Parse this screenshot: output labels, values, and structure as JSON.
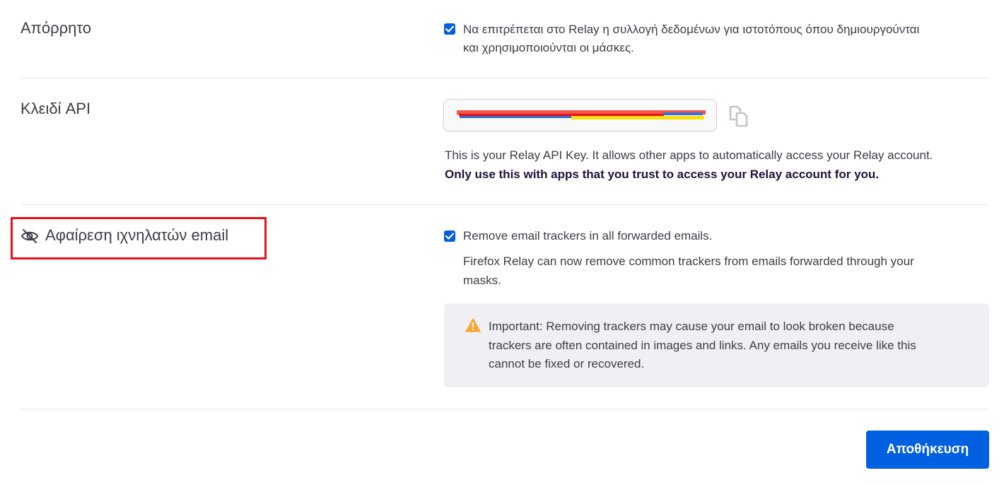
{
  "privacy": {
    "label": "Απόρρητο",
    "checked": true,
    "text_line1": "Να επιτρέπεται στο Relay η συλλογή δεδομένων για ιστοτόπους όπου δημιουργούνται",
    "text_line2": "και χρησιμοποιούνται οι μάσκες."
  },
  "api_key": {
    "label": "Κλειδί API",
    "description": "This is your Relay API Key. It allows other apps to automatically access your Relay account.",
    "warning": "Only use this with apps that you trust to access your Relay account for you."
  },
  "tracker_removal": {
    "label": "Αφαίρεση ιχνηλατών email",
    "checked": true,
    "checkbox_label": "Remove email trackers in all forwarded emails.",
    "description_line1": "Firefox Relay can now remove common trackers from emails forwarded through your",
    "description_line2": "masks.",
    "important_line1": "Important: Removing trackers may cause your email to look broken because",
    "important_line2": "trackers are often contained in images and links. Any emails you receive like this",
    "important_line3": "cannot be fixed or recovered."
  },
  "save_button": {
    "label": "Αποθήκευση"
  },
  "icons": {
    "privacy_checkbox": "checkbox-checked-icon",
    "copy": "copy-icon",
    "tracker": "eye-slash-icon",
    "tracker_checkbox": "checkbox-checked-icon",
    "warning": "warning-triangle-icon"
  },
  "colors": {
    "accent": "#0060df",
    "highlight": "#e8101a",
    "warning": "#ffa436"
  }
}
